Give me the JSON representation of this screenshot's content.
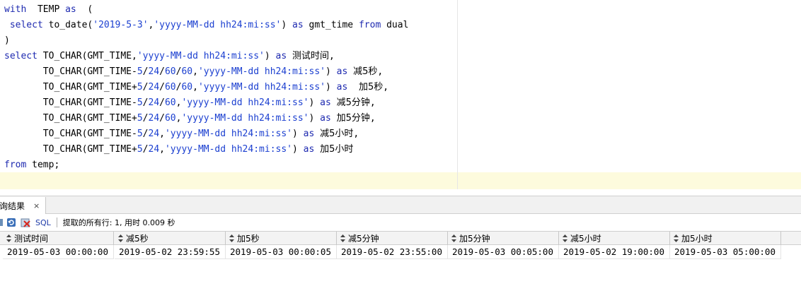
{
  "editor": {
    "lines": [
      [
        {
          "t": "with",
          "c": "kw"
        },
        {
          "t": "  TEMP "
        },
        {
          "t": "as",
          "c": "kw"
        },
        {
          "t": "  ("
        }
      ],
      [
        {
          "t": " "
        },
        {
          "t": "select",
          "c": "kw"
        },
        {
          "t": " to_date("
        },
        {
          "t": "'2019-5-3'",
          "c": "str"
        },
        {
          "t": ","
        },
        {
          "t": "'yyyy-MM-dd hh24:mi:ss'",
          "c": "str"
        },
        {
          "t": ") "
        },
        {
          "t": "as",
          "c": "kw"
        },
        {
          "t": " gmt_time "
        },
        {
          "t": "from",
          "c": "kw"
        },
        {
          "t": " dual"
        }
      ],
      [
        {
          "t": ")"
        }
      ],
      [
        {
          "t": "select",
          "c": "kw"
        },
        {
          "t": " TO_CHAR(GMT_TIME,"
        },
        {
          "t": "'yyyy-MM-dd hh24:mi:ss'",
          "c": "str"
        },
        {
          "t": ") "
        },
        {
          "t": "as",
          "c": "kw"
        },
        {
          "t": " "
        },
        {
          "t": "测试时间",
          "c": "cjk"
        },
        {
          "t": ","
        }
      ],
      [
        {
          "t": "       TO_CHAR(GMT_TIME-"
        },
        {
          "t": "5",
          "c": "num"
        },
        {
          "t": "/"
        },
        {
          "t": "24",
          "c": "num"
        },
        {
          "t": "/"
        },
        {
          "t": "60",
          "c": "num"
        },
        {
          "t": "/"
        },
        {
          "t": "60",
          "c": "num"
        },
        {
          "t": ","
        },
        {
          "t": "'yyyy-MM-dd hh24:mi:ss'",
          "c": "str"
        },
        {
          "t": ") "
        },
        {
          "t": "as",
          "c": "kw"
        },
        {
          "t": " "
        },
        {
          "t": "减5秒",
          "c": "cjk"
        },
        {
          "t": ","
        }
      ],
      [
        {
          "t": "       TO_CHAR(GMT_TIME+"
        },
        {
          "t": "5",
          "c": "num"
        },
        {
          "t": "/"
        },
        {
          "t": "24",
          "c": "num"
        },
        {
          "t": "/"
        },
        {
          "t": "60",
          "c": "num"
        },
        {
          "t": "/"
        },
        {
          "t": "60",
          "c": "num"
        },
        {
          "t": ","
        },
        {
          "t": "'yyyy-MM-dd hh24:mi:ss'",
          "c": "str"
        },
        {
          "t": ") "
        },
        {
          "t": "as",
          "c": "kw"
        },
        {
          "t": "  "
        },
        {
          "t": "加5秒",
          "c": "cjk"
        },
        {
          "t": ","
        }
      ],
      [
        {
          "t": "       TO_CHAR(GMT_TIME-"
        },
        {
          "t": "5",
          "c": "num"
        },
        {
          "t": "/"
        },
        {
          "t": "24",
          "c": "num"
        },
        {
          "t": "/"
        },
        {
          "t": "60",
          "c": "num"
        },
        {
          "t": ","
        },
        {
          "t": "'yyyy-MM-dd hh24:mi:ss'",
          "c": "str"
        },
        {
          "t": ") "
        },
        {
          "t": "as",
          "c": "kw"
        },
        {
          "t": " "
        },
        {
          "t": "减5分钟",
          "c": "cjk"
        },
        {
          "t": ","
        }
      ],
      [
        {
          "t": "       TO_CHAR(GMT_TIME+"
        },
        {
          "t": "5",
          "c": "num"
        },
        {
          "t": "/"
        },
        {
          "t": "24",
          "c": "num"
        },
        {
          "t": "/"
        },
        {
          "t": "60",
          "c": "num"
        },
        {
          "t": ","
        },
        {
          "t": "'yyyy-MM-dd hh24:mi:ss'",
          "c": "str"
        },
        {
          "t": ") "
        },
        {
          "t": "as",
          "c": "kw"
        },
        {
          "t": " "
        },
        {
          "t": "加5分钟",
          "c": "cjk"
        },
        {
          "t": ","
        }
      ],
      [
        {
          "t": "       TO_CHAR(GMT_TIME-"
        },
        {
          "t": "5",
          "c": "num"
        },
        {
          "t": "/"
        },
        {
          "t": "24",
          "c": "num"
        },
        {
          "t": ","
        },
        {
          "t": "'yyyy-MM-dd hh24:mi:ss'",
          "c": "str"
        },
        {
          "t": ") "
        },
        {
          "t": "as",
          "c": "kw"
        },
        {
          "t": " "
        },
        {
          "t": "减5小时",
          "c": "cjk"
        },
        {
          "t": ","
        }
      ],
      [
        {
          "t": "       TO_CHAR(GMT_TIME+"
        },
        {
          "t": "5",
          "c": "num"
        },
        {
          "t": "/"
        },
        {
          "t": "24",
          "c": "num"
        },
        {
          "t": ","
        },
        {
          "t": "'yyyy-MM-dd hh24:mi:ss'",
          "c": "str"
        },
        {
          "t": ") "
        },
        {
          "t": "as",
          "c": "kw"
        },
        {
          "t": " "
        },
        {
          "t": "加5小时",
          "c": "cjk"
        }
      ],
      [
        {
          "t": "from",
          "c": "kw"
        },
        {
          "t": " temp;"
        }
      ]
    ]
  },
  "results": {
    "tab_label": "询结果",
    "tab_close": "×",
    "toolbar": {
      "sql_label": "SQL",
      "status": "提取的所有行: 1, 用时 0.009 秒"
    },
    "columns": [
      "测试时间",
      "减5秒",
      "加5秒",
      "减5分钟",
      "加5分钟",
      "减5小时",
      "加5小时"
    ],
    "rows": [
      [
        "2019-05-03 00:00:00",
        "2019-05-02 23:59:55",
        "2019-05-03 00:00:05",
        "2019-05-02 23:55:00",
        "2019-05-03 00:05:00",
        "2019-05-02 19:00:00",
        "2019-05-03 05:00:00"
      ]
    ]
  },
  "colors": {
    "keyword": "#1e2ab0",
    "string": "#1b3fd0",
    "current_line": "#fdfbdd"
  }
}
